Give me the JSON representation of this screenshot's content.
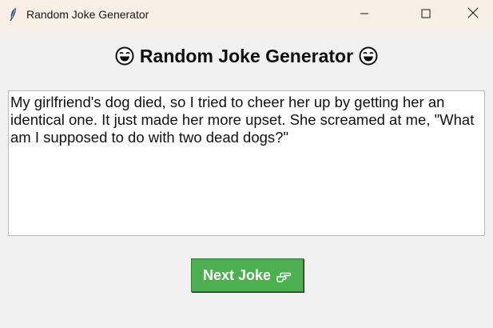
{
  "window": {
    "title": "Random Joke Generator",
    "controls": {
      "minimize_icon": "minimize-icon",
      "maximize_icon": "maximize-icon",
      "close_icon": "close-icon"
    }
  },
  "header": {
    "title": "Random Joke Generator",
    "emoji_icon": "laughing-face-icon"
  },
  "joke": {
    "text": "My girlfriend's dog died, so I tried to cheer her up by getting her an identical one. It just made her more upset. She screamed at me, \"What am I supposed to do with two dead dogs?\""
  },
  "actions": {
    "next_label": "Next Joke",
    "next_icon": "pointing-hand-icon"
  },
  "colors": {
    "button_bg": "#4caf50",
    "titlebar_bg": "#f7efe6",
    "window_bg": "#f0f0f0"
  }
}
